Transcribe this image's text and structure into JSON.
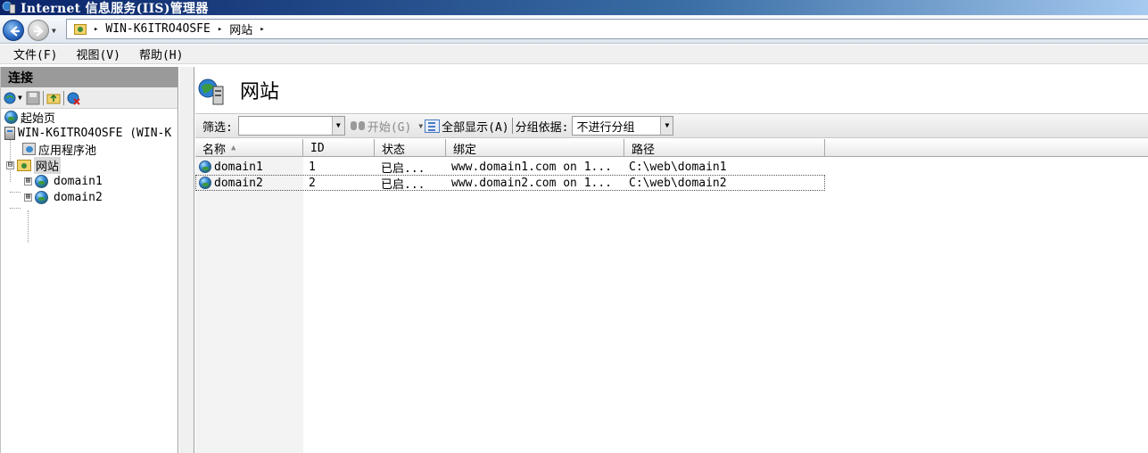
{
  "window": {
    "title": "Internet 信息服务(IIS)管理器"
  },
  "address": {
    "crumbs": [
      "WIN-K6ITRO4OSFE",
      "网站"
    ],
    "separator": "▸"
  },
  "menu": {
    "items": [
      "文件(F)",
      "视图(V)",
      "帮助(H)"
    ]
  },
  "connections": {
    "header": "连接",
    "tree": [
      {
        "label": "起始页",
        "icon": "start-page-icon"
      },
      {
        "label": "WIN-K6ITRO4OSFE (WIN-K",
        "icon": "server-icon",
        "expander": "⊟"
      },
      {
        "label": "应用程序池",
        "icon": "app-pool-icon"
      },
      {
        "label": "网站",
        "icon": "sites-folder-icon",
        "expander": "⊟",
        "selected": true
      },
      {
        "label": "domain1",
        "icon": "globe-icon",
        "expander": "⊞"
      },
      {
        "label": "domain2",
        "icon": "globe-icon",
        "expander": "⊞"
      }
    ]
  },
  "main": {
    "title": "网站",
    "filter": {
      "label": "筛选:",
      "value": "",
      "go_label": "开始(G)",
      "show_all_label": "全部显示(A)",
      "group_by_label": "分组依据:",
      "group_by_value": "不进行分组"
    },
    "columns": [
      "名称",
      "ID",
      "状态",
      "绑定",
      "路径"
    ],
    "sort_indicator": "▲",
    "rows": [
      {
        "name": "domain1",
        "id": "1",
        "status": "已启...",
        "binding": "www.domain1.com on 1...",
        "path": "C:\\web\\domain1"
      },
      {
        "name": "domain2",
        "id": "2",
        "status": "已启...",
        "binding": "www.domain2.com on 1...",
        "path": "C:\\web\\domain2"
      }
    ]
  }
}
